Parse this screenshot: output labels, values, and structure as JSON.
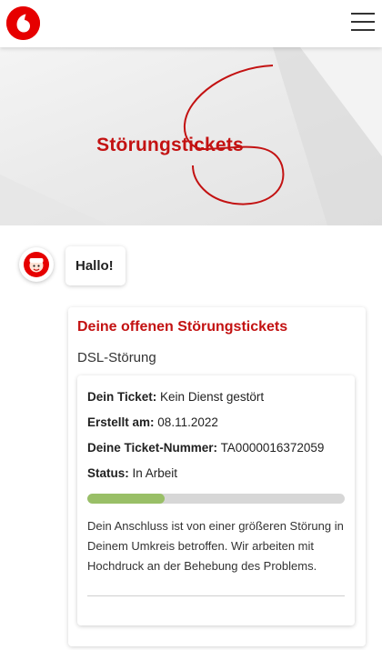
{
  "header": {
    "logo": "vodafone-logo",
    "menu_icon": "hamburger-menu-icon"
  },
  "hero": {
    "title": "Störungstickets"
  },
  "chat": {
    "avatar_icon": "bot-avatar-icon",
    "greeting": "Hallo!"
  },
  "card": {
    "title": "Deine offenen Störungstickets",
    "subtitle": "DSL-Störung",
    "ticket": {
      "ticket_label": "Dein Ticket:",
      "ticket_value": "Kein Dienst gestört",
      "created_label": "Erstellt am:",
      "created_value": "08.11.2022",
      "number_label": "Deine Ticket-Nummer:",
      "number_value": "TA0000016372059",
      "status_label": "Status:",
      "status_value": "In Arbeit",
      "progress_fraction": 0.3,
      "description": "Dein Anschluss ist von einer größeren Störung in Deinem Umkreis betroffen. Wir arbeiten mit Hochdruck an der Behebung des Problems."
    }
  },
  "colors": {
    "brand_red": "#e60000",
    "title_red": "#c31212",
    "progress_green": "#99bf67",
    "progress_track": "#d7d7d7"
  }
}
